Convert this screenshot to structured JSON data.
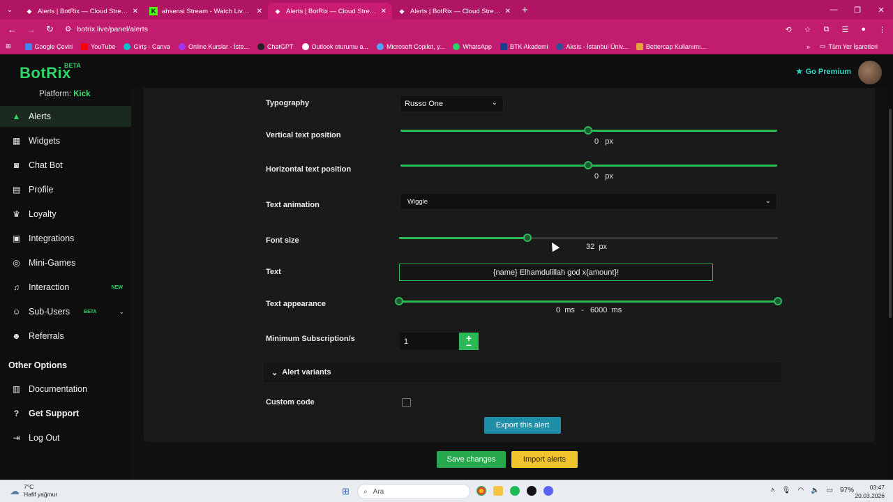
{
  "browser": {
    "tabs": [
      {
        "title": "Alerts | BotRix — Cloud Streami",
        "active": false
      },
      {
        "title": "ahsensi Stream - Watch Live on",
        "active": false
      },
      {
        "title": "Alerts | BotRix — Cloud Streami",
        "active": true
      },
      {
        "title": "Alerts | BotRix — Cloud Streami",
        "active": false
      }
    ],
    "url": "botrix.live/panel/alerts",
    "bookmarks": [
      "Google Çeviri",
      "YouTube",
      "Giriş - Canva",
      "Online Kurslar - İste...",
      "ChatGPT",
      "Outlook oturumu a...",
      "Microsoft Copilot, y...",
      "WhatsApp",
      "BTK Akademi",
      "Aksis - İstanbul Üniv...",
      "Bettercap Kullanımı..."
    ],
    "all_bookmarks": "Tüm Yer İşaretleri"
  },
  "app": {
    "logo": "BotRix",
    "logo_badge": "BETA",
    "go_premium": "Go Premium",
    "platform_label": "Platform:",
    "platform_value": "Kick"
  },
  "sidebar": {
    "items": [
      {
        "label": "Alerts",
        "icon": "warning-icon"
      },
      {
        "label": "Widgets",
        "icon": "grid-icon"
      },
      {
        "label": "Chat Bot",
        "icon": "robot-icon"
      },
      {
        "label": "Profile",
        "icon": "profile-card-icon"
      },
      {
        "label": "Loyalty",
        "icon": "trophy-icon"
      },
      {
        "label": "Integrations",
        "icon": "integrations-icon"
      },
      {
        "label": "Mini-Games",
        "icon": "gamepad-icon"
      },
      {
        "label": "Interaction",
        "icon": "music-icon",
        "badge": "NEW"
      },
      {
        "label": "Sub-Users",
        "icon": "users-icon",
        "badge": "BETA"
      },
      {
        "label": "Referrals",
        "icon": "referrals-icon"
      }
    ],
    "other_options_title": "Other Options",
    "other_items": [
      {
        "label": "Documentation",
        "icon": "document-icon"
      },
      {
        "label": "Get Support",
        "icon": "help-icon"
      },
      {
        "label": "Log Out",
        "icon": "logout-icon"
      }
    ]
  },
  "form": {
    "typography_label": "Typography",
    "typography_value": "Russo One",
    "vertical_label": "Vertical text position",
    "vertical_value": "0",
    "vertical_unit": "px",
    "vertical_fraction": 0.5,
    "horizontal_label": "Horizontal text position",
    "horizontal_value": "0",
    "horizontal_unit": "px",
    "horizontal_fraction": 0.5,
    "animation_label": "Text animation",
    "animation_value": "Wiggle",
    "font_size_label": "Font size",
    "font_size_value": "32",
    "font_size_unit": "px",
    "font_size_fraction": 0.34,
    "text_label": "Text",
    "text_value": "{name} Elhamdulillah god x{amount}!",
    "appearance_label": "Text appearance",
    "appearance_min": "0",
    "appearance_max": "6000",
    "appearance_unit": "ms",
    "appearance_sep": "-",
    "min_sub_label": "Minimum Subscription/s",
    "min_sub_value": "1",
    "variants_label": "Alert variants",
    "custom_code_label": "Custom code",
    "export_button": "Export this alert",
    "save_button": "Save changes",
    "import_button": "Import alerts"
  },
  "taskbar": {
    "temp": "7°C",
    "weather": "Hafif yağmur",
    "search_placeholder": "Ara",
    "battery": "97%",
    "time": "03:47",
    "date": "20.03.2026"
  }
}
